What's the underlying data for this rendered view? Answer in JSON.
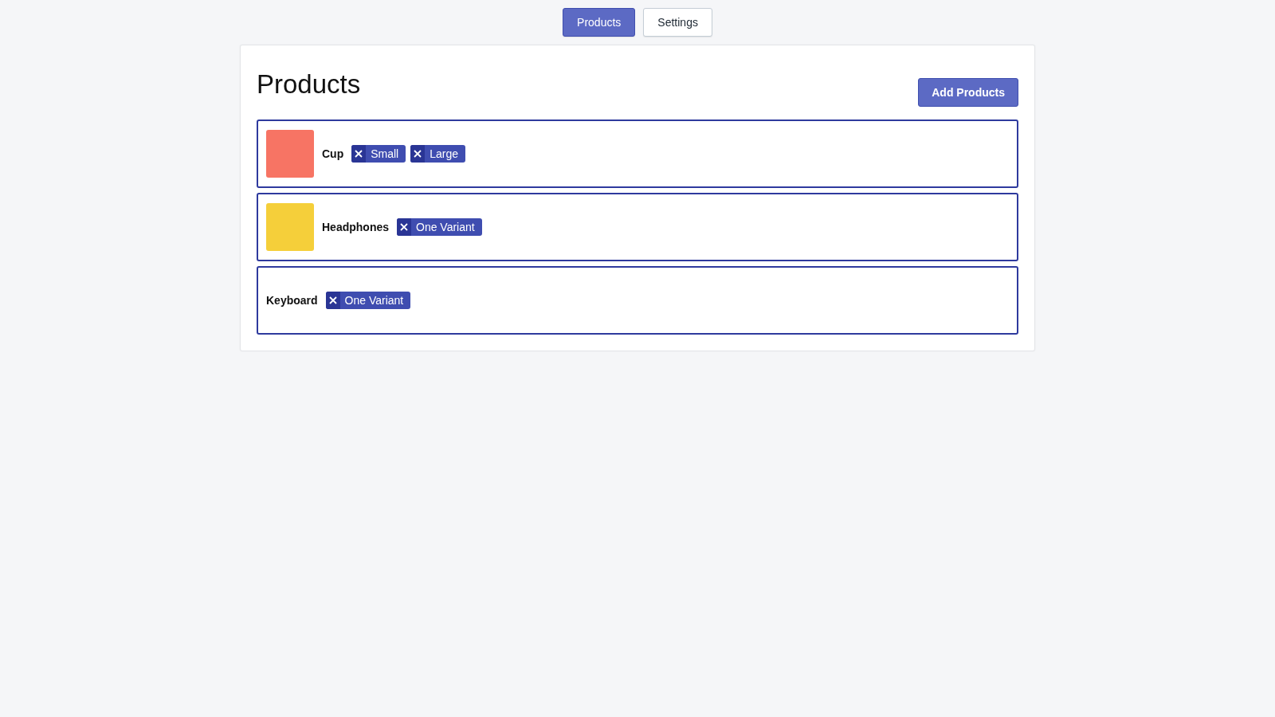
{
  "tabs": [
    {
      "label": "Products",
      "selected": true
    },
    {
      "label": "Settings",
      "selected": false
    }
  ],
  "page": {
    "title": "Products",
    "add_button": "Add Products"
  },
  "products": [
    {
      "name": "Cup",
      "image": {
        "color": "#f77464"
      },
      "variants": [
        "Small",
        "Large"
      ]
    },
    {
      "name": "Headphones",
      "image": {
        "color": "#f5cf3a"
      },
      "variants": [
        "One Variant"
      ]
    },
    {
      "name": "Keyboard",
      "variants": [
        "One Variant"
      ]
    }
  ]
}
